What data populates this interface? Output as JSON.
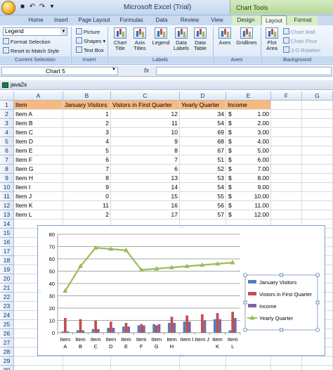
{
  "window": {
    "title": "Microsoft Excel (Trial)",
    "context_tab_group": "Chart Tools"
  },
  "ribbon": {
    "tabs": [
      "Home",
      "Insert",
      "Page Layout",
      "Formulas",
      "Data",
      "Review",
      "View",
      "Design",
      "Layout",
      "Format"
    ],
    "active_tab": "Layout",
    "current_selection": {
      "combo_value": "Legend",
      "format_selection": "Format Selection",
      "reset_style": "Reset to Match Style",
      "label": "Current Selection"
    },
    "insert": {
      "picture": "Picture",
      "shapes": "Shapes",
      "text_box": "Text Box",
      "label": "Insert"
    },
    "labels": {
      "chart_title": "Chart Title",
      "axis_titles": "Axis Titles",
      "legend": "Legend",
      "data_labels": "Data Labels",
      "data_table": "Data Table",
      "label": "Labels"
    },
    "axes": {
      "axes": "Axes",
      "gridlines": "Gridlines",
      "label": "Axes"
    },
    "background": {
      "plot_area": "Plot Area",
      "chart_wall": "Chart Wall",
      "chart_floor": "Chart Floor",
      "rotation": "3-D Rotation",
      "label": "Background"
    }
  },
  "formula_bar": {
    "name_box": "Chart 5",
    "fx": "fx",
    "formula": ""
  },
  "workbook": {
    "title": "java2s"
  },
  "sheet": {
    "columns": [
      "A",
      "B",
      "C",
      "D",
      "E",
      "F",
      "G"
    ],
    "rows": [
      "1",
      "2",
      "3",
      "4",
      "5",
      "6",
      "7",
      "8",
      "9",
      "10",
      "11",
      "12",
      "13",
      "14",
      "15",
      "16",
      "17",
      "18",
      "19",
      "20",
      "21",
      "22",
      "23",
      "24",
      "25",
      "26",
      "27",
      "28",
      "29",
      "30"
    ],
    "headers": [
      "Item",
      "January Visitors",
      "Vistors in First Quarter",
      "Yearly Quarter",
      "Income"
    ],
    "data": [
      [
        "Item A",
        "1",
        "12",
        "34",
        "1.00"
      ],
      [
        "Item B",
        "2",
        "11",
        "54",
        "2.00"
      ],
      [
        "Item C",
        "3",
        "10",
        "69",
        "3.00"
      ],
      [
        "Item D",
        "4",
        "9",
        "68",
        "4.00"
      ],
      [
        "Item E",
        "5",
        "8",
        "67",
        "5.00"
      ],
      [
        "Item F",
        "6",
        "7",
        "51",
        "6.00"
      ],
      [
        "Item G",
        "7",
        "6",
        "52",
        "7.00"
      ],
      [
        "Item H",
        "8",
        "13",
        "53",
        "8.00"
      ],
      [
        "Item I",
        "9",
        "14",
        "54",
        "9.00"
      ],
      [
        "Item J",
        "0",
        "15",
        "55",
        "10.00"
      ],
      [
        "Item K",
        "11",
        "16",
        "56",
        "11.00"
      ],
      [
        "Item L",
        "2",
        "17",
        "57",
        "12.00"
      ]
    ],
    "currency_symbol": "$"
  },
  "chart_data": {
    "type": "bar",
    "categories": [
      "Item A",
      "Item B",
      "Item C",
      "Item D",
      "Item E",
      "Item F",
      "Item G",
      "Item H",
      "Item I",
      "Item J",
      "Item K",
      "Item L"
    ],
    "series": [
      {
        "name": "January Visitors",
        "type": "bar",
        "color": "#4f81bd",
        "values": [
          1,
          2,
          3,
          4,
          5,
          6,
          7,
          8,
          9,
          0,
          11,
          2
        ]
      },
      {
        "name": "Vistors in First Quarter",
        "type": "bar",
        "color": "#c0504d",
        "values": [
          12,
          11,
          10,
          9,
          8,
          7,
          6,
          13,
          14,
          15,
          16,
          17
        ]
      },
      {
        "name": "Income",
        "type": "bar",
        "color": "#8064a2",
        "values": [
          1,
          2,
          3,
          4,
          5,
          6,
          7,
          8,
          9,
          10,
          11,
          12
        ]
      },
      {
        "name": "Yearly Quarter",
        "type": "line",
        "marker": "triangle",
        "color": "#9bbb59",
        "values": [
          34,
          54,
          69,
          68,
          67,
          51,
          52,
          53,
          54,
          55,
          56,
          57
        ]
      }
    ],
    "category_labels": [
      [
        "Item",
        "A"
      ],
      [
        "Item",
        "B"
      ],
      [
        "Item",
        "C"
      ],
      [
        "Item",
        "D"
      ],
      [
        "Item",
        "E"
      ],
      [
        "Item",
        "F"
      ],
      [
        "Item",
        "G"
      ],
      [
        "Item",
        "H"
      ],
      [
        "Item I",
        ""
      ],
      [
        "Item J",
        ""
      ],
      [
        "Item",
        "K"
      ],
      [
        "Item",
        "L"
      ]
    ],
    "y_ticks": [
      "0",
      "10",
      "20",
      "30",
      "40",
      "50",
      "60",
      "70",
      "80"
    ],
    "ylim": [
      0,
      80
    ],
    "grid": true,
    "legend_position": "right",
    "legend_order": [
      "January Visitors",
      "Vistors in First Quarter",
      "Income",
      "Yearly Quarter"
    ],
    "title": "",
    "xlabel": "",
    "ylabel": ""
  }
}
